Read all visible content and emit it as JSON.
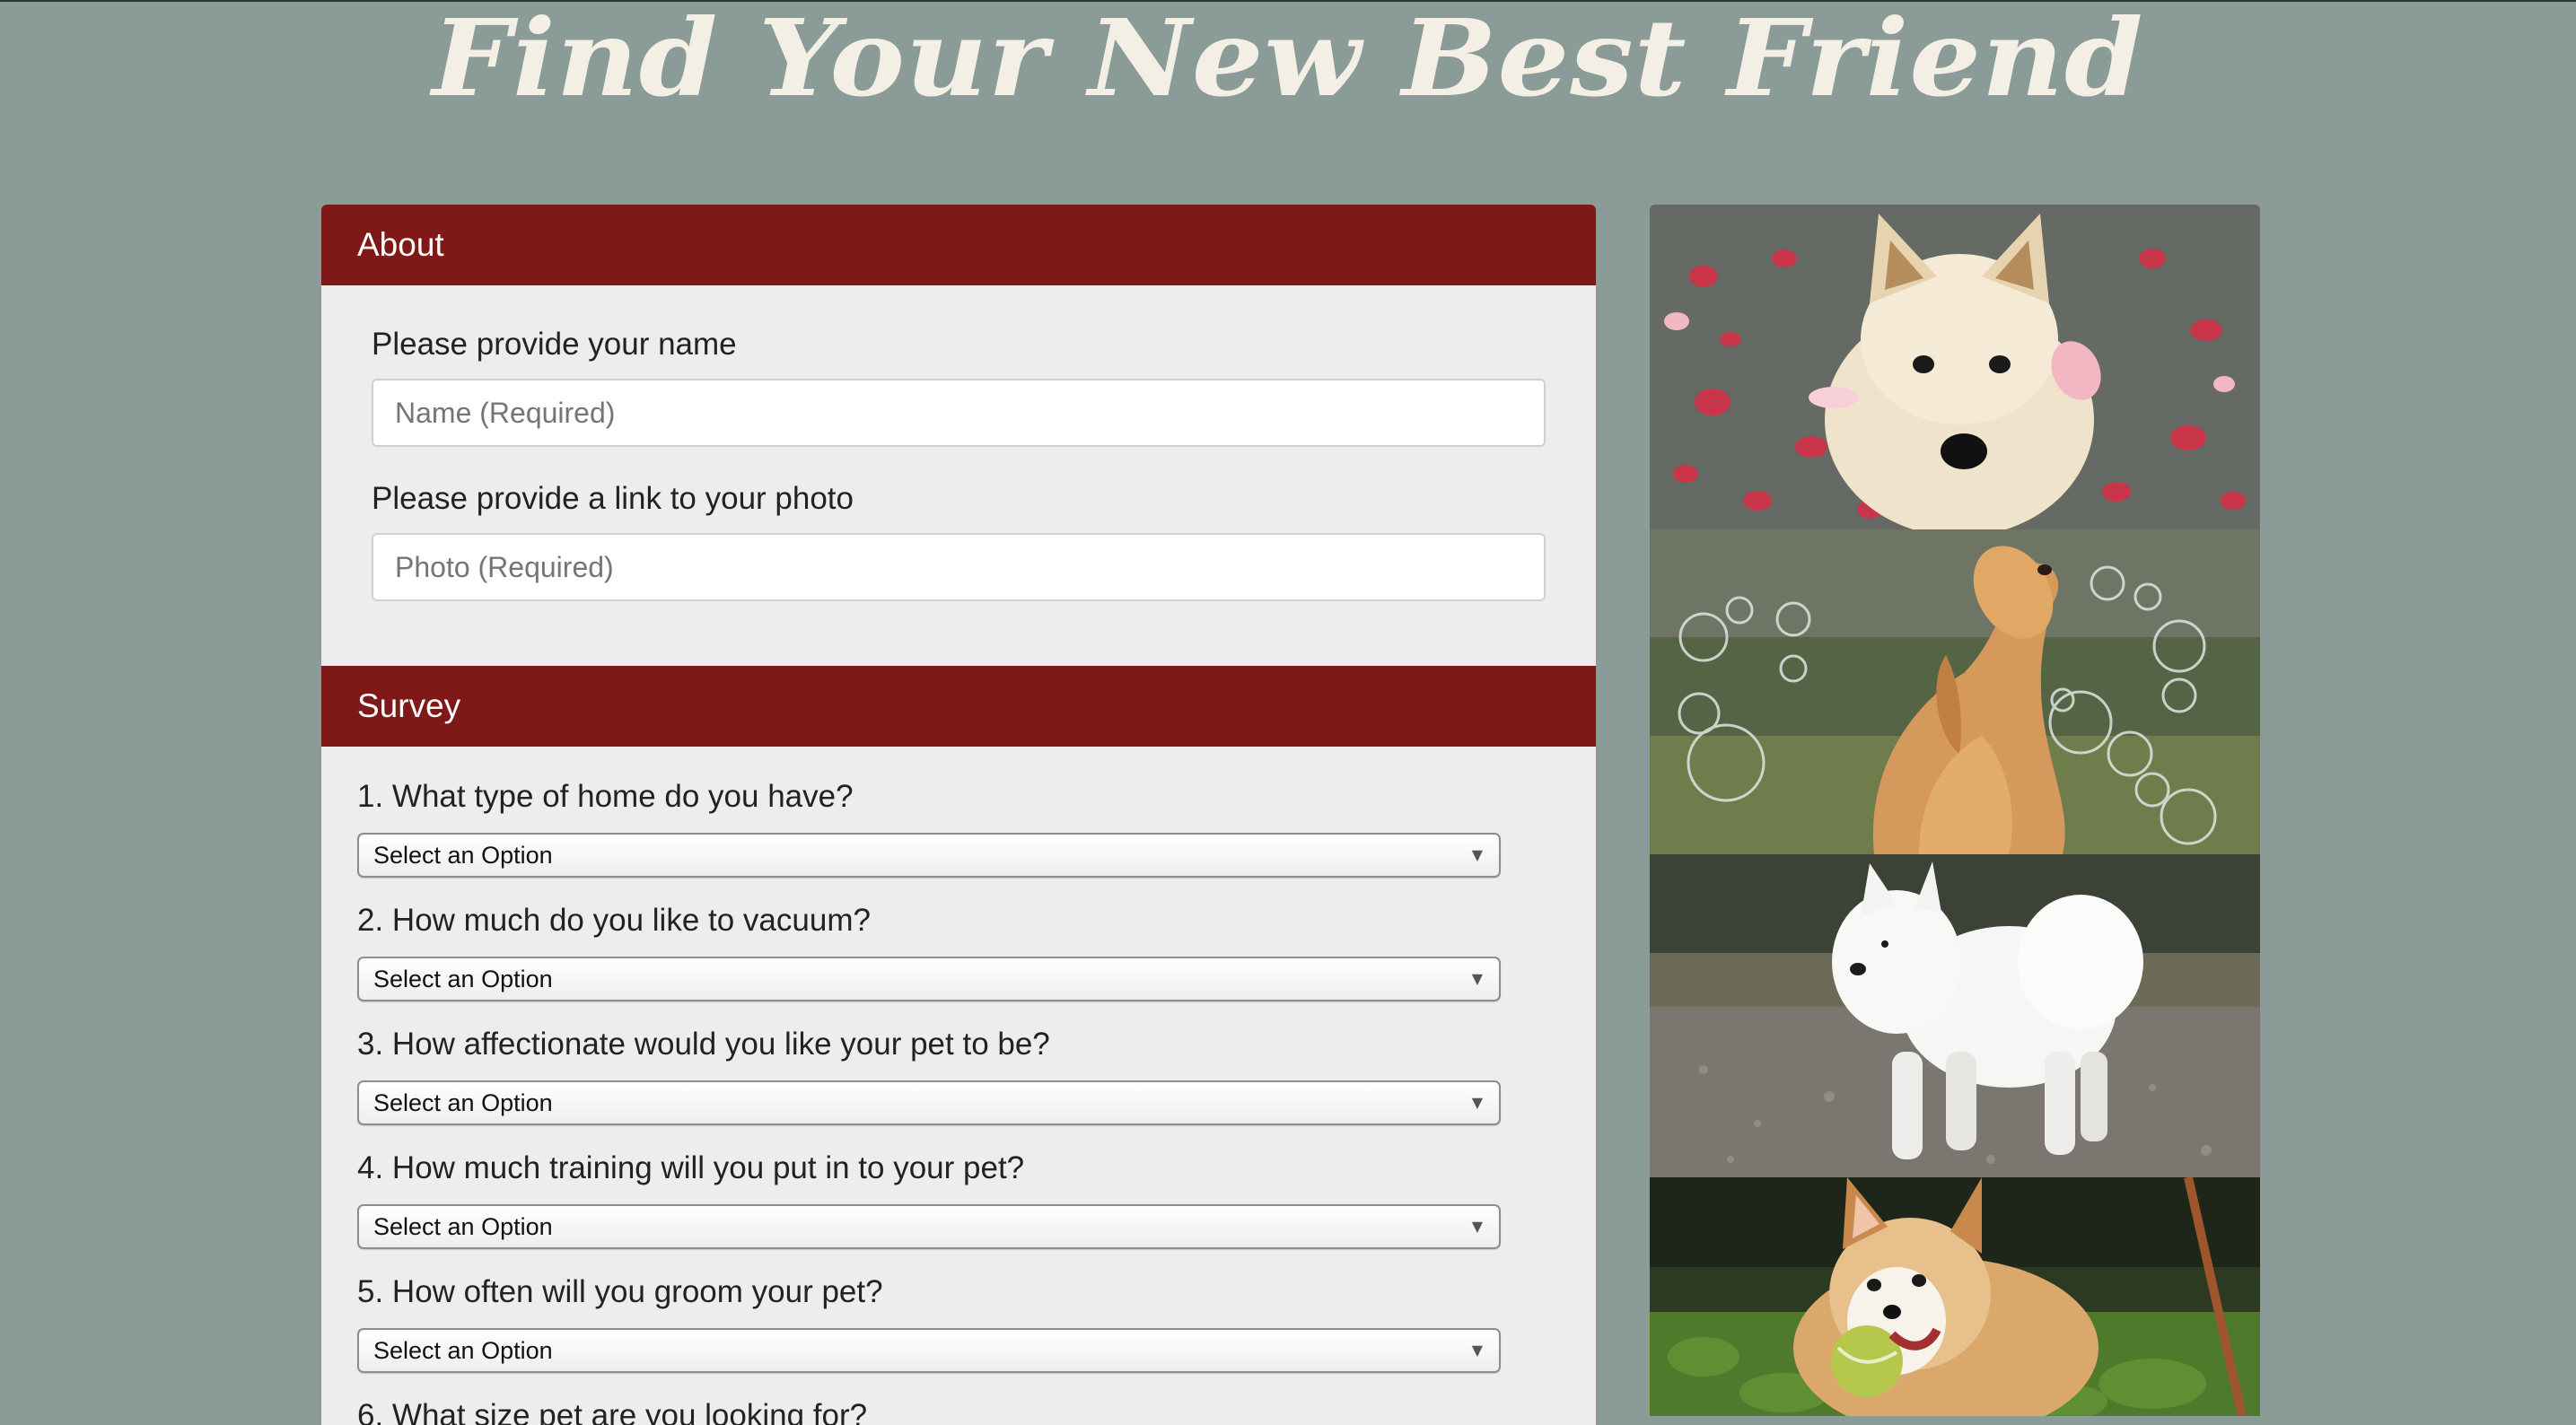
{
  "header": {
    "title": "Find Your New Best Friend"
  },
  "about": {
    "heading": "About",
    "name_label": "Please provide your name",
    "name_placeholder": "Name (Required)",
    "photo_label": "Please provide a link to your photo",
    "photo_placeholder": "Photo (Required)"
  },
  "survey": {
    "heading": "Survey",
    "questions": [
      {
        "text": "1. What type of home do you have?",
        "selected": "Select an Option"
      },
      {
        "text": "2. How much do you like to vacuum?",
        "selected": "Select an Option"
      },
      {
        "text": "3. How affectionate would you like your pet to be?",
        "selected": "Select an Option"
      },
      {
        "text": "4. How much training will you put in to your pet?",
        "selected": "Select an Option"
      },
      {
        "text": "5. How often will you groom your pet?",
        "selected": "Select an Option"
      },
      {
        "text": "6. What size pet are you looking for?"
      }
    ]
  },
  "gallery": {
    "photos": [
      {
        "icon": "shiba-inu-petals-photo"
      },
      {
        "icon": "golden-retriever-bubbles-photo"
      },
      {
        "icon": "samoyed-photo"
      },
      {
        "icon": "corgi-ball-photo"
      }
    ]
  },
  "colors": {
    "background": "#8a9b98",
    "header_bar": "#7e1917",
    "card": "#efedeb",
    "title": "#f3efe4"
  }
}
